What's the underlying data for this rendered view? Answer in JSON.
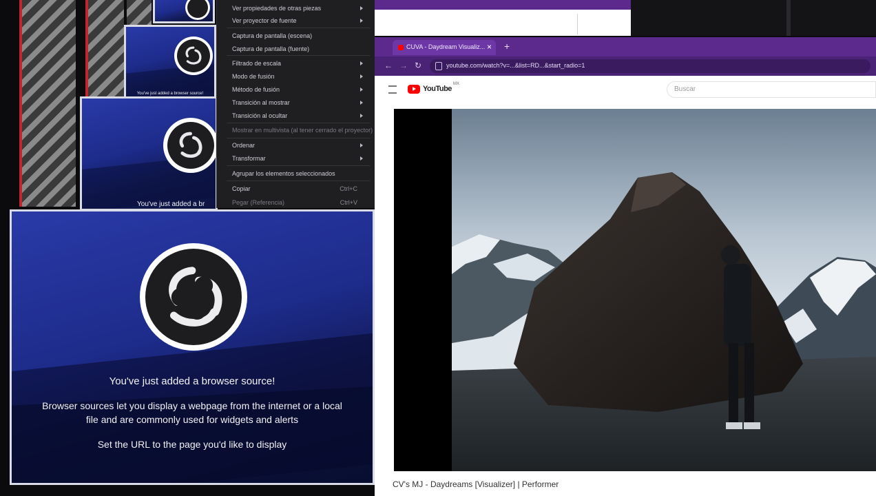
{
  "context_menu": {
    "items": [
      {
        "label": "Ver propiedades de otras piezas",
        "submenu": true
      },
      {
        "label": "Ver proyector de fuente",
        "submenu": true
      },
      {
        "label": "Captura de pantalla (escena)",
        "submenu": false
      },
      {
        "label": "Captura de pantalla (fuente)",
        "submenu": false
      },
      {
        "label": "Filtrado de escala",
        "submenu": true
      },
      {
        "label": "Modo de fusión",
        "submenu": true
      },
      {
        "label": "Método de fusión",
        "submenu": true
      },
      {
        "label": "Transición al mostrar",
        "submenu": true
      },
      {
        "label": "Transición al ocultar",
        "submenu": true
      },
      {
        "label": "Mostrar en multivista (al tener cerrado el proyector)",
        "submenu": false,
        "dim": true
      },
      {
        "label": "Ordenar",
        "submenu": true
      },
      {
        "label": "Transformar",
        "submenu": true
      },
      {
        "label": "Agrupar los elementos seleccionados",
        "submenu": false
      },
      {
        "label": "Copiar",
        "shortcut": "Ctrl+C"
      },
      {
        "label": "Pegar (Referencia)",
        "shortcut": "Ctrl+V",
        "dim": true
      }
    ]
  },
  "obs_small_panel_texts": {
    "panel_mid": "You've just added a browser source!",
    "panel_low": "You've just added a br"
  },
  "obs_main_panel": {
    "heading": "You've just added a browser source!",
    "body_line1": "Browser sources let you display a webpage from the internet or a local",
    "body_line2": "file and are commonly used for widgets and alerts",
    "instruction": "Set the URL to the page you'd like to display"
  },
  "browser": {
    "tab_title": "CUVA - Daydream Visualiz...",
    "tab_close": "×",
    "new_tab": "+",
    "url": "youtube.com/watch?v=...&list=RD...&start_radio=1",
    "logo_text": "YouTube",
    "logo_superscript": "MX",
    "search_placeholder": "Buscar"
  },
  "video": {
    "title": "CV's MJ - Daydreams [Visualizer] | Performer"
  },
  "colors": {
    "obs_blue": "#2a3aa8",
    "browser_purple": "#5b2a8c",
    "youtube_red": "#ff0000"
  }
}
